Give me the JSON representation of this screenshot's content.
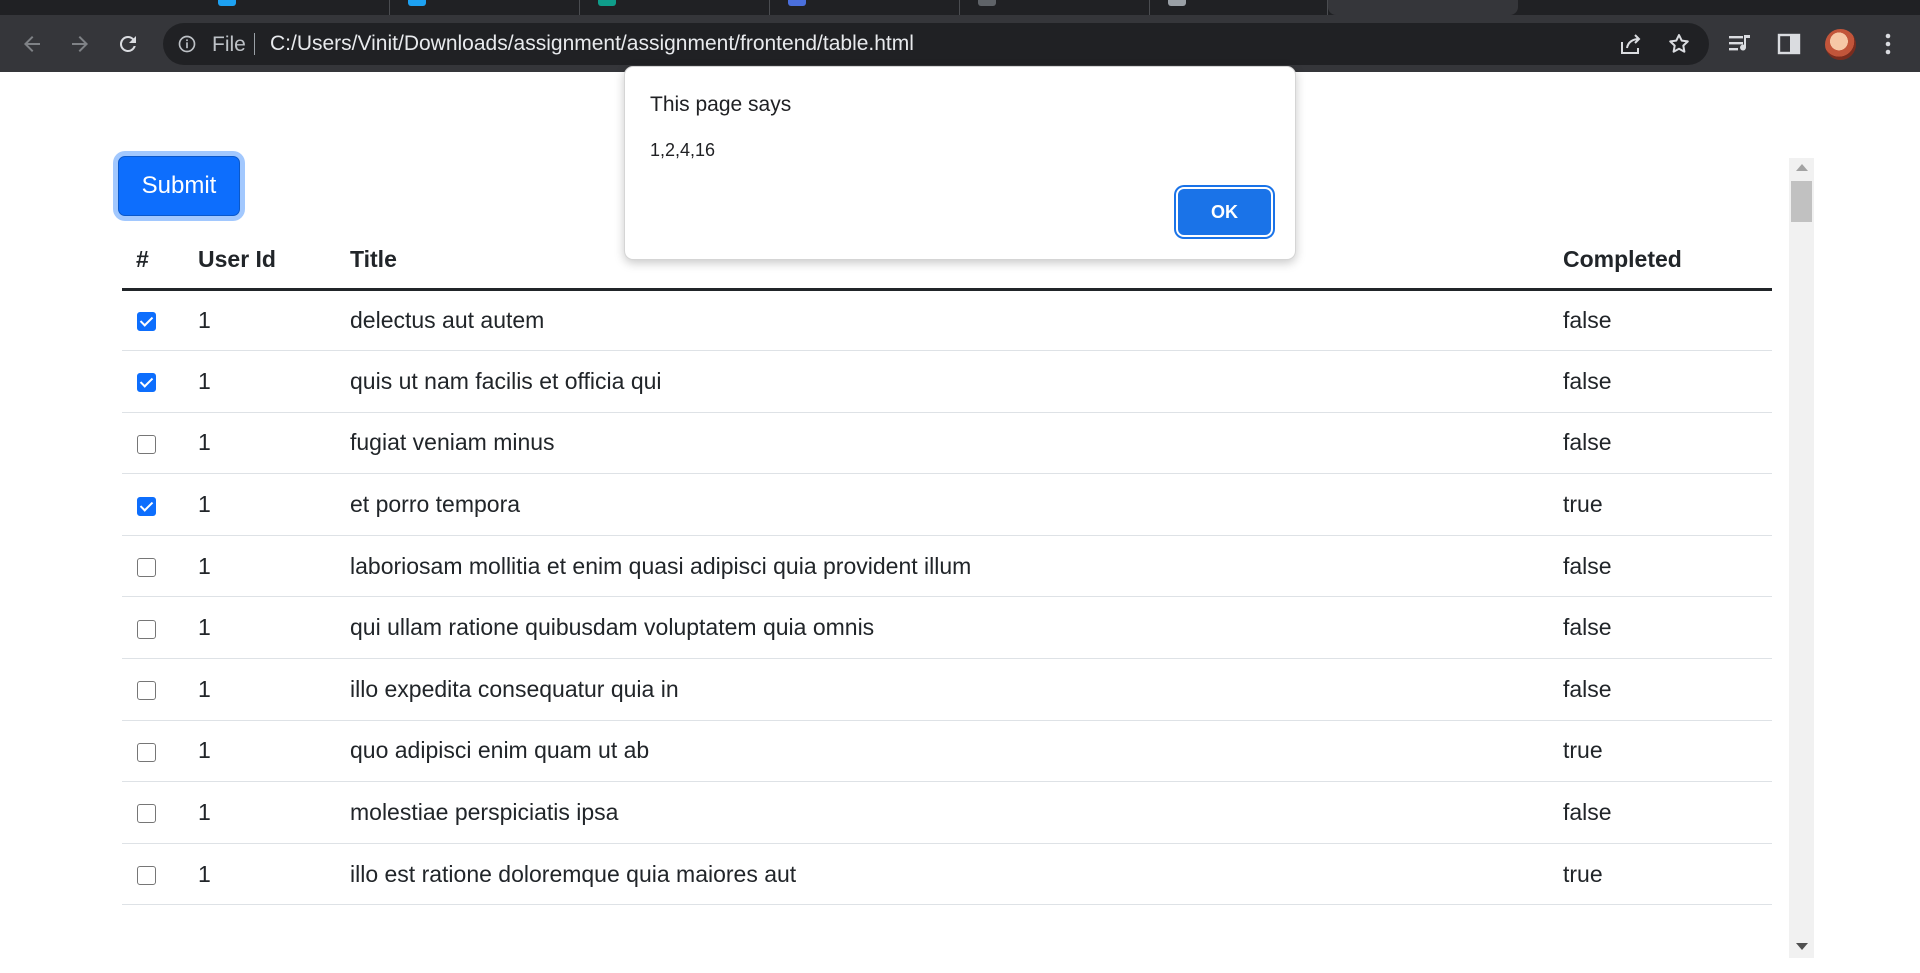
{
  "browser": {
    "omnibox": {
      "scheme_label": "File",
      "url": "C:/Users/Vinit/Downloads/assignment/assignment/frontend/table.html"
    },
    "icons": {
      "back": "back-arrow-icon",
      "forward": "forward-arrow-icon",
      "reload": "reload-icon",
      "info": "info-icon",
      "share": "share-icon",
      "bookmark": "star-icon",
      "media": "media-queue-icon",
      "side_panel": "side-panel-icon",
      "menu": "kebab-menu-icon"
    },
    "colors": {
      "chrome": "#35363a",
      "omnibox": "#202124"
    }
  },
  "page": {
    "submit_label": "Submit",
    "table": {
      "headers": [
        "#",
        "User Id",
        "Title",
        "Completed"
      ],
      "rows": [
        {
          "checked": true,
          "user_id": "1",
          "title": "delectus aut autem",
          "completed": "false"
        },
        {
          "checked": true,
          "user_id": "1",
          "title": "quis ut nam facilis et officia qui",
          "completed": "false"
        },
        {
          "checked": false,
          "user_id": "1",
          "title": "fugiat veniam minus",
          "completed": "false"
        },
        {
          "checked": true,
          "user_id": "1",
          "title": "et porro tempora",
          "completed": "true"
        },
        {
          "checked": false,
          "user_id": "1",
          "title": "laboriosam mollitia et enim quasi adipisci quia provident illum",
          "completed": "false"
        },
        {
          "checked": false,
          "user_id": "1",
          "title": "qui ullam ratione quibusdam voluptatem quia omnis",
          "completed": "false"
        },
        {
          "checked": false,
          "user_id": "1",
          "title": "illo expedita consequatur quia in",
          "completed": "false"
        },
        {
          "checked": false,
          "user_id": "1",
          "title": "quo adipisci enim quam ut ab",
          "completed": "true"
        },
        {
          "checked": false,
          "user_id": "1",
          "title": "molestiae perspiciatis ipsa",
          "completed": "false"
        },
        {
          "checked": false,
          "user_id": "1",
          "title": "illo est ratione doloremque quia maiores aut",
          "completed": "true"
        }
      ]
    },
    "colors": {
      "primary": "#0d6efd",
      "text": "#212529"
    }
  },
  "dialog": {
    "title": "This page says",
    "message": "1,2,4,16",
    "ok_label": "OK",
    "accent": "#1a73e8"
  }
}
